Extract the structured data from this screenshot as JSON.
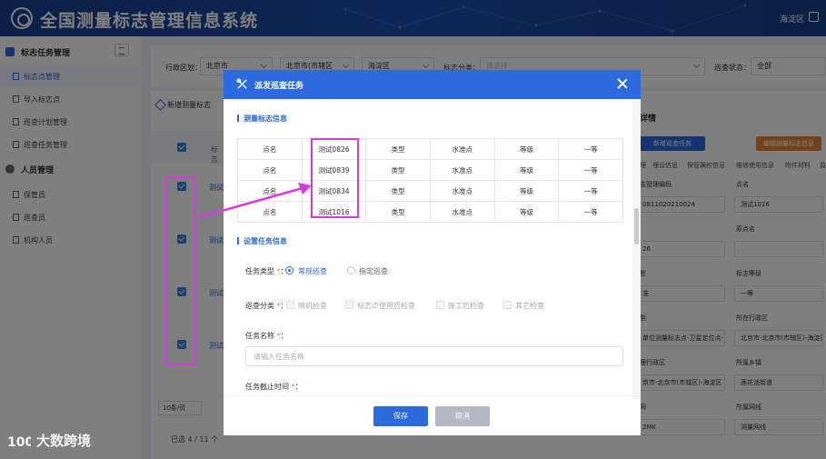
{
  "header": {
    "title": "全国测量标志管理信息系统",
    "region": "海淀区"
  },
  "sidebar": {
    "groups": [
      {
        "label": "标志任务管理",
        "items": [
          "标志点管理",
          "导入标志点",
          "巡查计划管理",
          "巡查任务管理"
        ]
      },
      {
        "label": "人员管理",
        "items": [
          "保管员",
          "巡查员",
          "机构人员"
        ]
      }
    ]
  },
  "filters": {
    "district_label": "行政区划：",
    "province": "北京市",
    "city": "北京市(市辖区",
    "county": "海淀区",
    "category_label": "标志分类：",
    "category_placeholder": "请选择",
    "status_label": "巡查状态：",
    "status_value": "全部"
  },
  "table": {
    "add_button": "新增测量标志",
    "header_partial": "标志",
    "row_link": "测试",
    "page_size": "10条/页",
    "selected": "已选 4 / 11 个"
  },
  "detail": {
    "title": "详情",
    "new_task_button": "新增巡查任务",
    "edit_button": "编辑测量标志信息",
    "tabs": [
      "理",
      "埋设信息",
      "保管确权信息",
      "维修使用信息",
      "附件材料",
      "监"
    ],
    "fields": [
      {
        "label": "志管理编码",
        "value": "0811020210024"
      },
      {
        "label": "点名",
        "value": "测试1016"
      },
      {
        "label": "原点名",
        "value": ""
      },
      {
        "label": "",
        "value": "26"
      },
      {
        "label": "型",
        "value": "准"
      },
      {
        "label": "标志等级",
        "value": "一等"
      },
      {
        "label": "型",
        "value": "单位测量标志点-卫星定位点-"
      },
      {
        "label": "所在行政区",
        "value": "北京市-北京市(市辖区)-海淀区"
      },
      {
        "label": "理行政区",
        "value": "京市-北京市(市辖区)-海淀区"
      },
      {
        "label": "所属乡镇",
        "value": "莲花池街道"
      },
      {
        "label": "网",
        "value": ""
      },
      {
        "label": "所属网线",
        "value": "测量网线"
      },
      {
        "label": "",
        "value": "2MK"
      }
    ]
  },
  "modal": {
    "title": "派发巡查任务",
    "section1": "测量标志信息",
    "rows": [
      {
        "c1": "点名",
        "c2": "测试0826",
        "c3": "类型",
        "c4": "水准点",
        "c5": "等级",
        "c6": "一等"
      },
      {
        "c1": "点名",
        "c2": "测试0839",
        "c3": "类型",
        "c4": "水准点",
        "c5": "等级",
        "c6": "一等"
      },
      {
        "c1": "点名",
        "c2": "测试0834",
        "c3": "类型",
        "c4": "水准点",
        "c5": "等级",
        "c6": "一等"
      },
      {
        "c1": "点名",
        "c2": "测试1016",
        "c3": "类型",
        "c4": "水准点",
        "c5": "等级",
        "c6": "一等"
      }
    ],
    "section2": "设置任务信息",
    "task_type_label": "任务类型",
    "task_type_options": [
      "常规巡查",
      "指定巡查"
    ],
    "category_label": "巡查分类",
    "category_options": [
      "随机检查",
      "标志点使用后检查",
      "施工后检查",
      "其它检查"
    ],
    "task_name_label": "任务名称",
    "task_name_placeholder": "请输入任务名称",
    "deadline_label": "任务截止时间",
    "save": "保存",
    "cancel": "取消"
  },
  "watermark": "大数跨境",
  "colors": {
    "primary": "#2c6ae0",
    "header": "#1a3f8f",
    "highlight": "#d63be2",
    "orange": "#e8873a"
  }
}
